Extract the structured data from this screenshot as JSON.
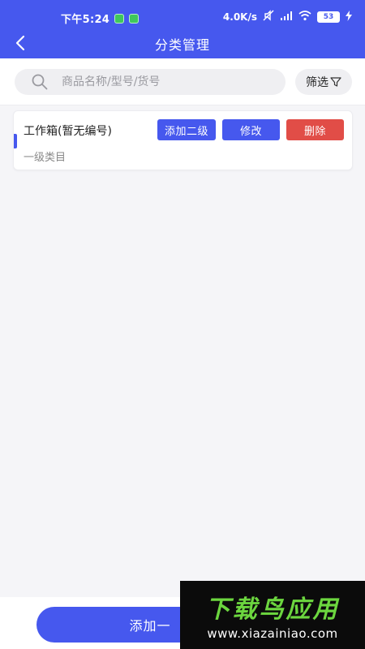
{
  "status_bar": {
    "time": "下午5:24",
    "network_speed": "4.0K/s",
    "battery": "53"
  },
  "nav": {
    "title": "分类管理",
    "back_icon": "chevron-left-icon"
  },
  "search": {
    "placeholder": "商品名称/型号/货号",
    "filter_label": "筛选",
    "icon": "search-icon"
  },
  "categories": [
    {
      "name": "工作箱(暂无编号)",
      "level": "一级类目",
      "add_sub_label": "添加二级",
      "edit_label": "修改",
      "delete_label": "删除"
    }
  ],
  "bottom": {
    "primary_label": "添加一"
  },
  "watermark": {
    "title": "下载鸟应用",
    "url": "www.xiazainiao.com"
  },
  "colors": {
    "primary": "#4658ee",
    "danger": "#e14d47",
    "watermark_green": "#6cd63f"
  }
}
